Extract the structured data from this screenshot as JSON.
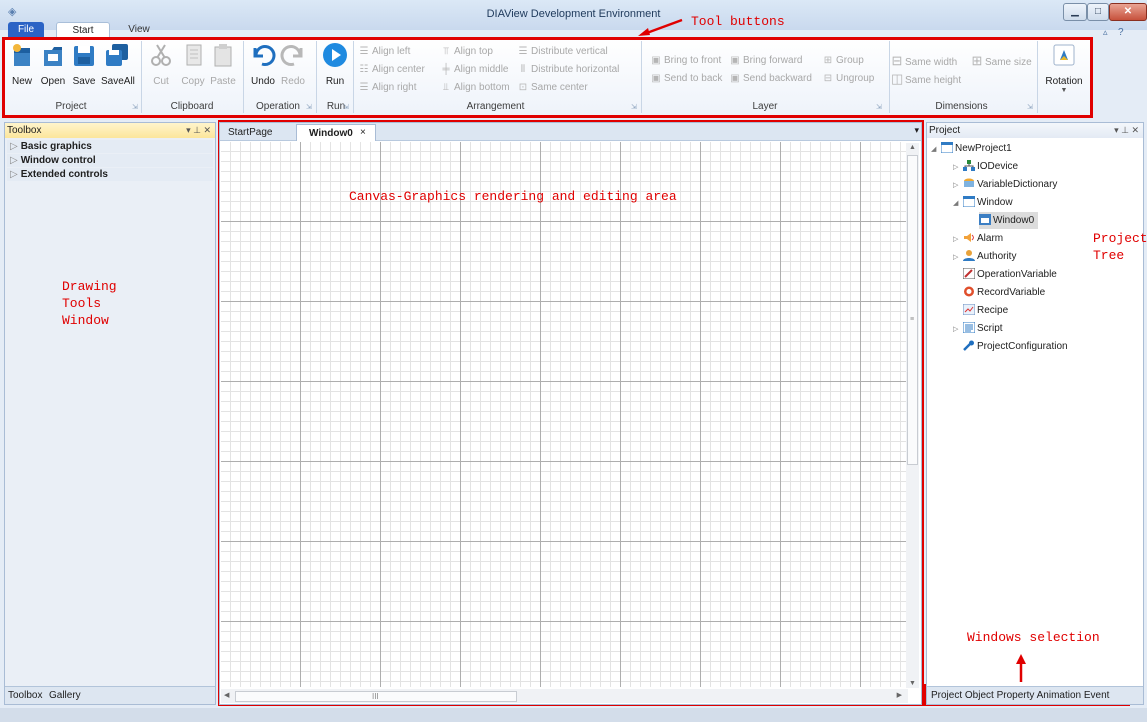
{
  "window": {
    "title": "DIAView Development Environment"
  },
  "ribbon_tabs": [
    "File",
    "Start",
    "View"
  ],
  "ribbon": {
    "project": {
      "label": "Project",
      "buttons": [
        "New",
        "Open",
        "Save",
        "SaveAll"
      ]
    },
    "clipboard": {
      "label": "Clipboard",
      "buttons": [
        "Cut",
        "Copy",
        "Paste"
      ]
    },
    "operation": {
      "label": "Operation",
      "buttons": [
        "Undo",
        "Redo"
      ]
    },
    "run": {
      "label": "Run",
      "button": "Run"
    },
    "arrangement": {
      "label": "Arrangement",
      "items": [
        "Align left",
        "Align center",
        "Align right",
        "Align top",
        "Align middle",
        "Align bottom",
        "Distribute vertical",
        "Distribute horizontal",
        "Same center"
      ]
    },
    "layer": {
      "label": "Layer",
      "items": [
        "Bring to front",
        "Bring forward",
        "Group",
        "Send to back",
        "Send backward",
        "Ungroup"
      ]
    },
    "dimensions": {
      "label": "Dimensions",
      "items": [
        "Same width",
        "Same size",
        "Same height"
      ]
    },
    "rotation": {
      "label": "Rotation"
    }
  },
  "toolbox": {
    "title": "Toolbox",
    "items": [
      "Basic graphics",
      "Window control",
      "Extended controls"
    ],
    "tabs": [
      "Toolbox",
      "Gallery"
    ]
  },
  "document_tabs": [
    "StartPage",
    "Window0"
  ],
  "project_panel": {
    "title": "Project",
    "tree": [
      "NewProject1",
      "IODevice",
      "VariableDictionary",
      "Window",
      "Window0",
      "Alarm",
      "Authority",
      "OperationVariable",
      "RecordVariable",
      "Recipe",
      "Script",
      "ProjectConfiguration"
    ],
    "tabs": [
      "Project",
      "Object",
      "Property",
      "Animation",
      "Event"
    ]
  },
  "annotations": {
    "tool_buttons": "Tool buttons",
    "canvas": "Canvas-Graphics rendering and editing area",
    "drawing_tools": "Drawing\nTools\nWindow",
    "project_tree": "Project\nTree",
    "windows_selection": "Windows selection"
  },
  "colors": {
    "annotation": "#e00000",
    "file_tab": "#2b63c5",
    "panel_header": "#fce69b"
  }
}
